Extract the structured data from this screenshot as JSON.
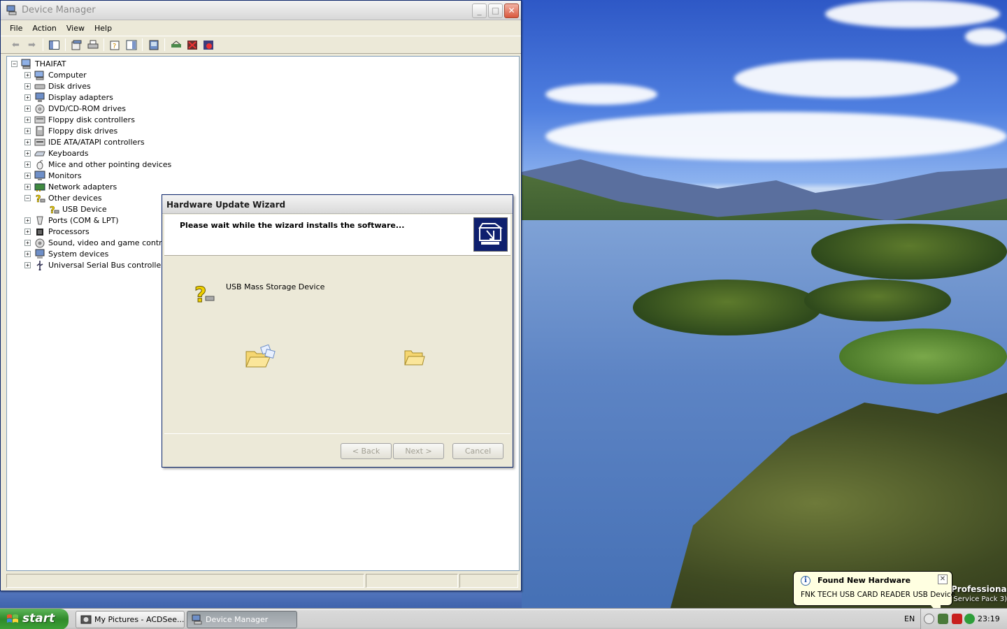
{
  "device_manager": {
    "title": "Device Manager",
    "menu": [
      "File",
      "Action",
      "View",
      "Help"
    ],
    "tree": {
      "root": "THAIFAT",
      "categories": [
        {
          "label": "Computer",
          "icon": "computer-icon",
          "expanded": false
        },
        {
          "label": "Disk drives",
          "icon": "disk-drive-icon",
          "expanded": false
        },
        {
          "label": "Display adapters",
          "icon": "display-adapter-icon",
          "expanded": false
        },
        {
          "label": "DVD/CD-ROM drives",
          "icon": "cdrom-icon",
          "expanded": false
        },
        {
          "label": "Floppy disk controllers",
          "icon": "floppy-controller-icon",
          "expanded": false
        },
        {
          "label": "Floppy disk drives",
          "icon": "floppy-drive-icon",
          "expanded": false
        },
        {
          "label": "IDE ATA/ATAPI controllers",
          "icon": "ide-controller-icon",
          "expanded": false
        },
        {
          "label": "Keyboards",
          "icon": "keyboard-icon",
          "expanded": false
        },
        {
          "label": "Mice and other pointing devices",
          "icon": "mouse-icon",
          "expanded": false
        },
        {
          "label": "Monitors",
          "icon": "monitor-icon",
          "expanded": false
        },
        {
          "label": "Network adapters",
          "icon": "network-adapter-icon",
          "expanded": false
        },
        {
          "label": "Other devices",
          "icon": "unknown-device-icon",
          "expanded": true,
          "children": [
            "USB Device"
          ]
        },
        {
          "label": "Ports (COM & LPT)",
          "icon": "port-icon",
          "expanded": false
        },
        {
          "label": "Processors",
          "icon": "processor-icon",
          "expanded": false
        },
        {
          "label": "Sound, video and game controllers",
          "icon": "sound-icon",
          "expanded": false
        },
        {
          "label": "System devices",
          "icon": "system-device-icon",
          "expanded": false
        },
        {
          "label": "Universal Serial Bus controllers",
          "icon": "usb-controller-icon",
          "expanded": false
        }
      ]
    }
  },
  "wizard": {
    "title": "Hardware Update Wizard",
    "message": "Please wait while the wizard installs the software...",
    "device_name": "USB Mass Storage Device",
    "buttons": {
      "back": "< Back",
      "next": "Next >",
      "cancel": "Cancel"
    }
  },
  "balloon": {
    "title": "Found New Hardware",
    "text": "FNK TECH  USB CARD READER USB Device"
  },
  "os_badge": {
    "edition": "Professional",
    "service_pack": "Service Pack 3)"
  },
  "taskbar": {
    "start_label": "start",
    "tasks": [
      {
        "label": "My Pictures - ACDSee...",
        "active": false
      },
      {
        "label": "Device Manager",
        "active": true
      }
    ],
    "language": "EN",
    "clock": "23:19"
  },
  "colors": {
    "start_green": "#3ea238",
    "wizard_icon_bg": "#0e1f6e",
    "balloon_bg": "#ffffe1",
    "tree_border": "#7f9db9"
  }
}
